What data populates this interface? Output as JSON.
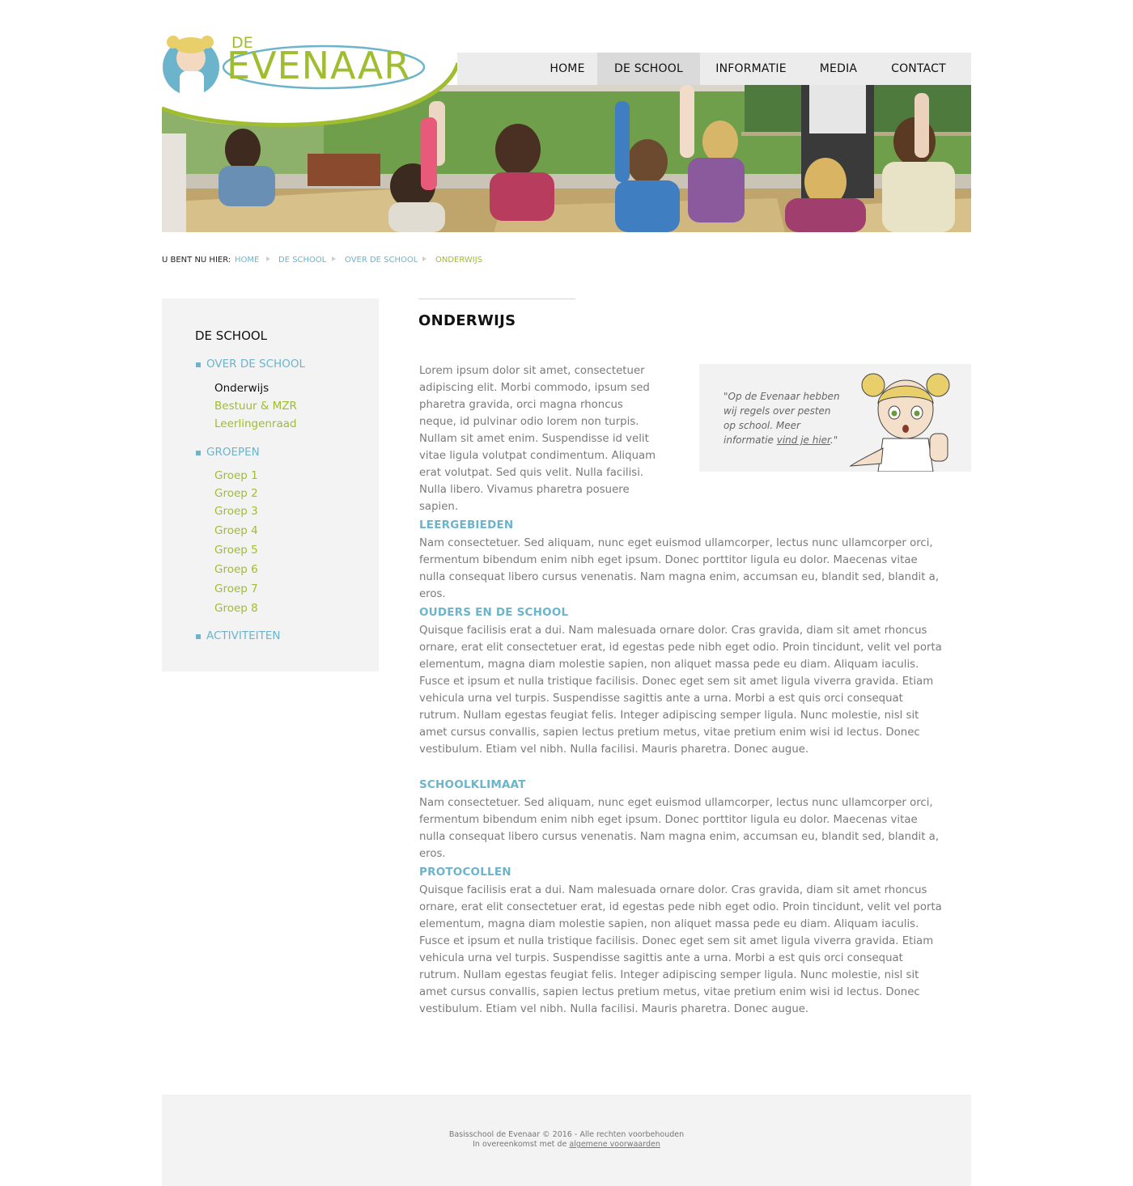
{
  "brand": {
    "logo_top": "DE",
    "logo_main": "EVENAAR",
    "colors": {
      "green": "#9fbd2f",
      "blue": "#6cb4cc",
      "nav_bg": "#ececec",
      "nav_active": "#dadada"
    }
  },
  "nav": {
    "items": [
      {
        "label": "HOME",
        "active": false
      },
      {
        "label": "DE SCHOOL",
        "active": true
      },
      {
        "label": "INFORMATIE",
        "active": false
      },
      {
        "label": "MEDIA",
        "active": false
      },
      {
        "label": "CONTACT",
        "active": false
      }
    ]
  },
  "breadcrumb": {
    "prefix": "U BENT NU HIER:",
    "links": [
      "HOME",
      "DE SCHOOL",
      "OVER DE SCHOOL"
    ],
    "current": "ONDERWIJS"
  },
  "sidebar": {
    "title": "DE SCHOOL",
    "over": {
      "label": "OVER DE SCHOOL",
      "items": [
        "Onderwijs",
        "Bestuur & MZR",
        "Leerlingenraad"
      ]
    },
    "groepen": {
      "label": "GROEPEN",
      "items": [
        "Groep 1",
        "Groep 2",
        "Groep 3",
        "Groep 4",
        "Groep 5",
        "Groep 6",
        "Groep 7",
        "Groep 8"
      ]
    },
    "activiteiten": {
      "label": "ACTIVITEITEN"
    }
  },
  "main": {
    "title": "ONDERWIJS",
    "intro": "Lorem ipsum dolor sit amet, consectetuer adipiscing elit. Morbi commodo, ipsum sed pharetra gravida, orci magna rhoncus neque, id pulvinar odio lorem non turpis. Nullam sit amet enim. Suspendisse id velit vitae ligula volutpat condimentum. Aliquam erat volutpat. Sed quis velit. Nulla facilisi. Nulla libero. Vivamus pharetra posuere sapien.",
    "quote": {
      "before": "\"Op de Evenaar hebben wij regels over pesten op school. Meer informatie ",
      "link": "vind je hier",
      "after": ".\""
    },
    "sections": [
      {
        "heading": "LEERGEBIEDEN",
        "text": "Nam consectetuer. Sed aliquam, nunc eget euismod ullamcorper, lectus nunc ullamcorper orci, fermentum bibendum enim nibh eget ipsum. Donec porttitor ligula eu dolor. Maecenas vitae nulla consequat libero cursus venenatis. Nam magna enim, accumsan eu, blandit sed, blandit a, eros."
      },
      {
        "heading": "OUDERS EN DE SCHOOL",
        "text": "Quisque facilisis erat a dui. Nam malesuada ornare dolor. Cras gravida, diam sit amet rhoncus ornare, erat elit consectetuer erat, id egestas pede nibh eget odio. Proin tincidunt, velit vel porta elementum, magna diam molestie sapien, non aliquet massa pede eu diam. Aliquam iaculis. Fusce et ipsum et nulla tristique facilisis. Donec eget sem sit amet ligula viverra gravida. Etiam vehicula urna vel turpis. Suspendisse sagittis ante a urna. Morbi a est quis orci consequat rutrum. Nullam egestas feugiat felis. Integer adipiscing semper ligula. Nunc molestie, nisl sit amet cursus convallis, sapien lectus pretium metus, vitae pretium enim wisi id lectus. Donec vestibulum. Etiam vel nibh. Nulla facilisi. Mauris pharetra. Donec augue."
      },
      {
        "heading": "SCHOOLKLIMAAT",
        "text": "Nam consectetuer. Sed aliquam, nunc eget euismod ullamcorper, lectus nunc ullamcorper orci, fermentum bibendum enim nibh eget ipsum. Donec porttitor ligula eu dolor. Maecenas vitae nulla consequat libero cursus venenatis. Nam magna enim, accumsan eu, blandit sed, blandit a, eros."
      },
      {
        "heading": "PROTOCOLLEN",
        "text": "Quisque facilisis erat a dui. Nam malesuada ornare dolor. Cras gravida, diam sit amet rhoncus ornare, erat elit consectetuer erat, id egestas pede nibh eget odio. Proin tincidunt, velit vel porta elementum, magna diam molestie sapien, non aliquet massa pede eu diam. Aliquam iaculis. Fusce et ipsum et nulla tristique facilisis. Donec eget sem sit amet ligula viverra gravida. Etiam vehicula urna vel turpis. Suspendisse sagittis ante a urna. Morbi a est quis orci consequat rutrum. Nullam egestas feugiat felis. Integer adipiscing semper ligula. Nunc molestie, nisl sit amet cursus convallis, sapien lectus pretium metus, vitae pretium enim wisi id lectus. Donec vestibulum. Etiam vel nibh. Nulla facilisi. Mauris pharetra. Donec augue."
      }
    ]
  },
  "footer": {
    "line1": "Basisschool de Evenaar © 2016 - Alle rechten voorbehouden",
    "line2_before": "In overeenkomst met de ",
    "line2_link": "algemene voorwaarden"
  }
}
